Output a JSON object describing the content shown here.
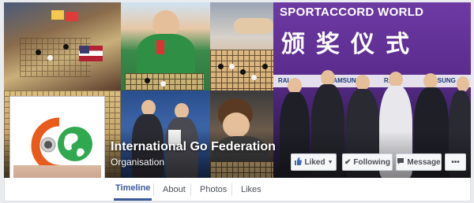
{
  "page": {
    "name": "International Go Federation",
    "category": "Organisation"
  },
  "cover": {
    "banner_text": "SPORTACCORD WORLD",
    "chinese_text": "颁奖仪式",
    "sponsors": [
      "RAI",
      "SAMSUNG",
      "RAI",
      "SAMSUNG"
    ]
  },
  "actions": {
    "liked_label": "Liked",
    "following_label": "Following",
    "message_label": "Message",
    "more_label": "•••"
  },
  "nav": {
    "tabs": [
      {
        "label": "Timeline",
        "active": true
      },
      {
        "label": "About",
        "active": false
      },
      {
        "label": "Photos",
        "active": false
      },
      {
        "label": "Likes",
        "active": false
      }
    ]
  },
  "icons": {
    "liked": "thumbs-up-icon",
    "following": "check-icon",
    "message": "message-icon",
    "more": "more-icon",
    "dropdown": "caret-down-icon"
  },
  "colors": {
    "facebook_blue": "#3b5998",
    "button_bg": "#f6f7f9",
    "logo_orange": "#e85b1a",
    "logo_green": "#2fa84f"
  }
}
